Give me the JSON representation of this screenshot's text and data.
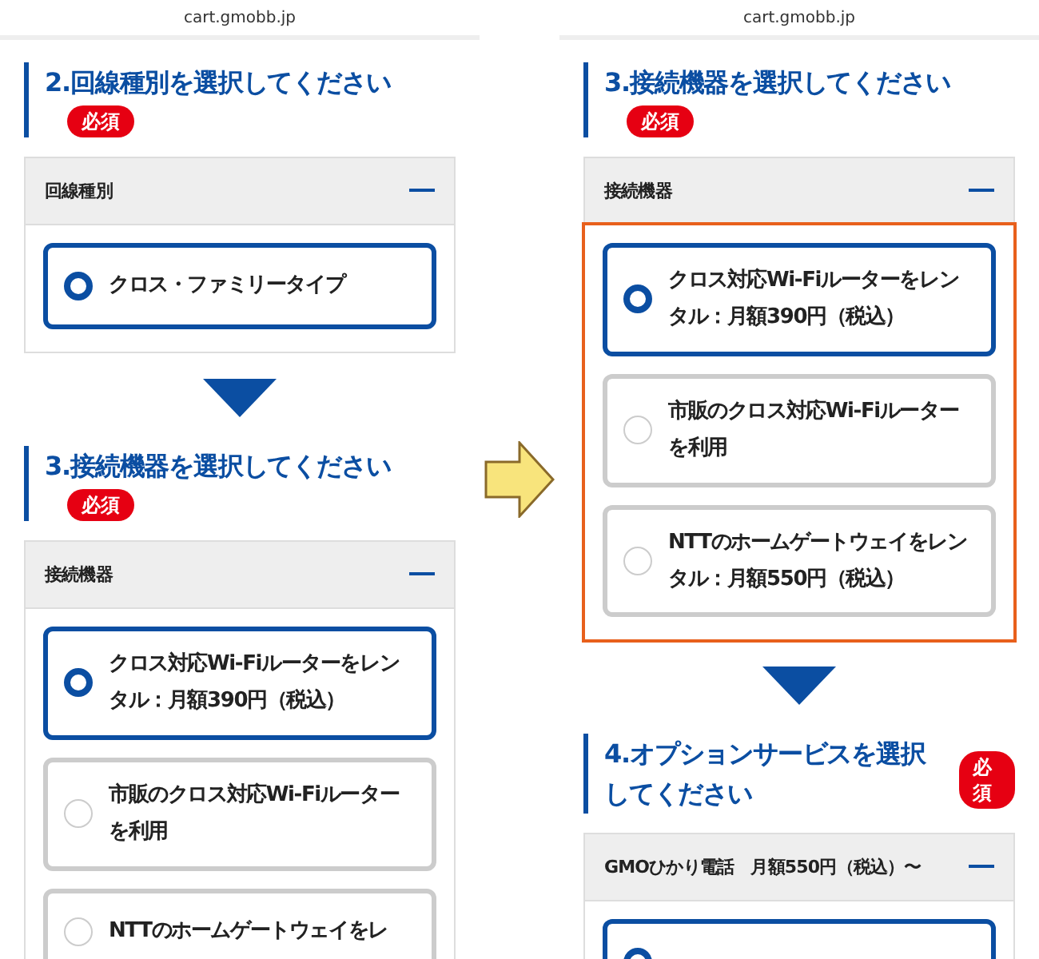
{
  "panels": [
    {
      "url": "cart.gmobb.jp",
      "blocks": [
        {
          "kind": "section",
          "title": "2.回線種別を選択してください",
          "badge": "必須",
          "accordion": {
            "header": "回線種別",
            "highlighted": false,
            "options": [
              {
                "label": "クロス・ファミリータイプ",
                "selected": true
              }
            ]
          }
        },
        {
          "kind": "arrow"
        },
        {
          "kind": "section",
          "title": "3.接続機器を選択してください",
          "badge": "必須",
          "accordion": {
            "header": "接続機器",
            "highlighted": false,
            "options": [
              {
                "label": "クロス対応Wi-Fiルーターをレンタル：月額390円（税込）",
                "selected": true
              },
              {
                "label": "市販のクロス対応Wi-Fiルーターを利用",
                "selected": false
              },
              {
                "label": "NTTのホームゲートウェイをレ",
                "selected": false
              }
            ]
          }
        }
      ]
    },
    {
      "url": "cart.gmobb.jp",
      "blocks": [
        {
          "kind": "section",
          "title": "3.接続機器を選択してください",
          "badge": "必須",
          "accordion": {
            "header": "接続機器",
            "highlighted": true,
            "options": [
              {
                "label": "クロス対応Wi-Fiルーターをレンタル：月額390円（税込）",
                "selected": true
              },
              {
                "label": "市販のクロス対応Wi-Fiルーターを利用",
                "selected": false
              },
              {
                "label": "NTTのホームゲートウェイをレンタル：月額550円（税込）",
                "selected": false
              }
            ]
          }
        },
        {
          "kind": "arrow"
        },
        {
          "kind": "section",
          "title": "4.オプションサービスを選択してください",
          "badge": "必須",
          "accordion": {
            "header": "GMOひかり電話　月額550円（税込）〜",
            "highlighted": false,
            "options": [
              {
                "selected": true
              }
            ]
          }
        }
      ]
    }
  ]
}
